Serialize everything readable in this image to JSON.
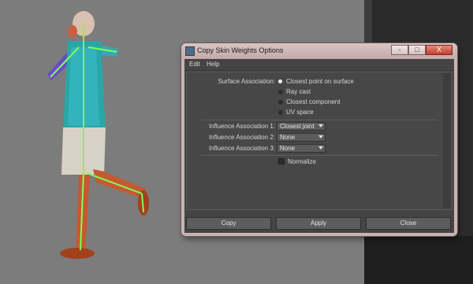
{
  "window": {
    "title": "Copy Skin Weights Options",
    "controls": {
      "minimize": "-",
      "maximize": "□",
      "close": "X"
    }
  },
  "menu": [
    "Edit",
    "Help"
  ],
  "surface_association": {
    "label": "Surface Association:",
    "options": [
      "Closest point on surface",
      "Ray cast",
      "Closest component",
      "UV space"
    ],
    "selected": "Closest point on surface"
  },
  "influence": [
    {
      "label": "Influence Association 1:",
      "value": "Closest joint"
    },
    {
      "label": "Influence Association 2:",
      "value": "None"
    },
    {
      "label": "Influence Association 3:",
      "value": "None"
    }
  ],
  "normalize": {
    "label": "Normalize",
    "checked": false
  },
  "buttons": {
    "copy": "Copy",
    "apply": "Apply",
    "close": "Close"
  }
}
